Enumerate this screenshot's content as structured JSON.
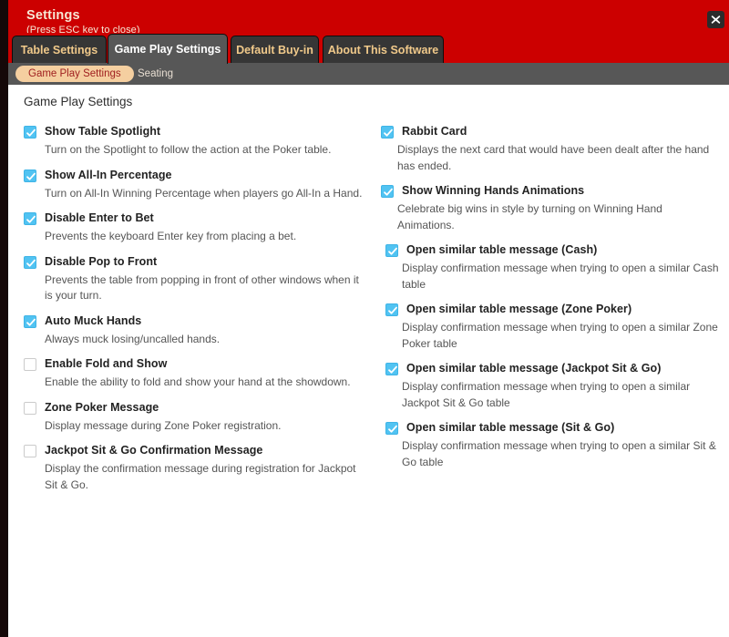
{
  "window": {
    "title": "Settings",
    "subtitle": "(Press ESC key to close)",
    "close_label": "close-icon",
    "accent_color": "#cc0000",
    "tabbar_bg": "#575757",
    "checkbox_on_color": "#51c3f2"
  },
  "tabs": [
    {
      "label": "Table Settings",
      "active": false
    },
    {
      "label": "Game Play Settings",
      "active": true
    },
    {
      "label": "Default Buy-in",
      "active": false
    },
    {
      "label": "About This Software",
      "active": false
    }
  ],
  "subtabs": [
    {
      "label": "Game Play Settings",
      "active": true
    },
    {
      "label": "Seating",
      "active": false
    }
  ],
  "main": {
    "section_title": "Game Play Settings",
    "left_options": [
      {
        "label": "Show Table Spotlight",
        "description": "Turn on the Spotlight to follow the action at the Poker table.",
        "checked": true
      },
      {
        "label": "Show All-In Percentage",
        "description": "Turn on All-In Winning Percentage when players go All-In a Hand.",
        "checked": true
      },
      {
        "label": "Disable Enter to Bet",
        "description": "Prevents the keyboard Enter key from placing a bet.",
        "checked": true
      },
      {
        "label": "Disable Pop to Front",
        "description": "Prevents the table from popping in front of other windows when it is your turn.",
        "checked": true
      },
      {
        "label": "Auto Muck Hands",
        "description": "Always muck losing/uncalled hands.",
        "checked": true
      },
      {
        "label": "Enable Fold and Show",
        "description": "Enable the ability to fold and show your hand at the showdown.",
        "checked": false
      },
      {
        "label": "Zone Poker Message",
        "description": "Display message during Zone Poker registration.",
        "checked": false
      },
      {
        "label": "Jackpot Sit & Go Confirmation Message",
        "description": "Display the confirmation message during registration for Jackpot Sit & Go.",
        "checked": false
      }
    ],
    "right_options": [
      {
        "label": "Rabbit Card",
        "description": "Displays the next card that would have been dealt after the hand has ended.",
        "checked": true,
        "indent": false
      },
      {
        "label": "Show Winning Hands Animations",
        "description": "Celebrate big wins in style by turning on Winning Hand Animations.",
        "checked": true,
        "indent": false
      },
      {
        "label": "Open similar table message (Cash)",
        "description": "Display confirmation message when trying to open a similar Cash table",
        "checked": true,
        "indent": true
      },
      {
        "label": "Open similar table message (Zone Poker)",
        "description": "Display confirmation message when trying to open a similar Zone Poker table",
        "checked": true,
        "indent": true
      },
      {
        "label": "Open similar table message (Jackpot Sit & Go)",
        "description": "Display confirmation message when trying to open a similar Jackpot Sit & Go table",
        "checked": true,
        "indent": true
      },
      {
        "label": "Open similar table message (Sit & Go)",
        "description": "Display confirmation message when trying to open a similar Sit & Go table",
        "checked": true,
        "indent": true
      }
    ]
  }
}
